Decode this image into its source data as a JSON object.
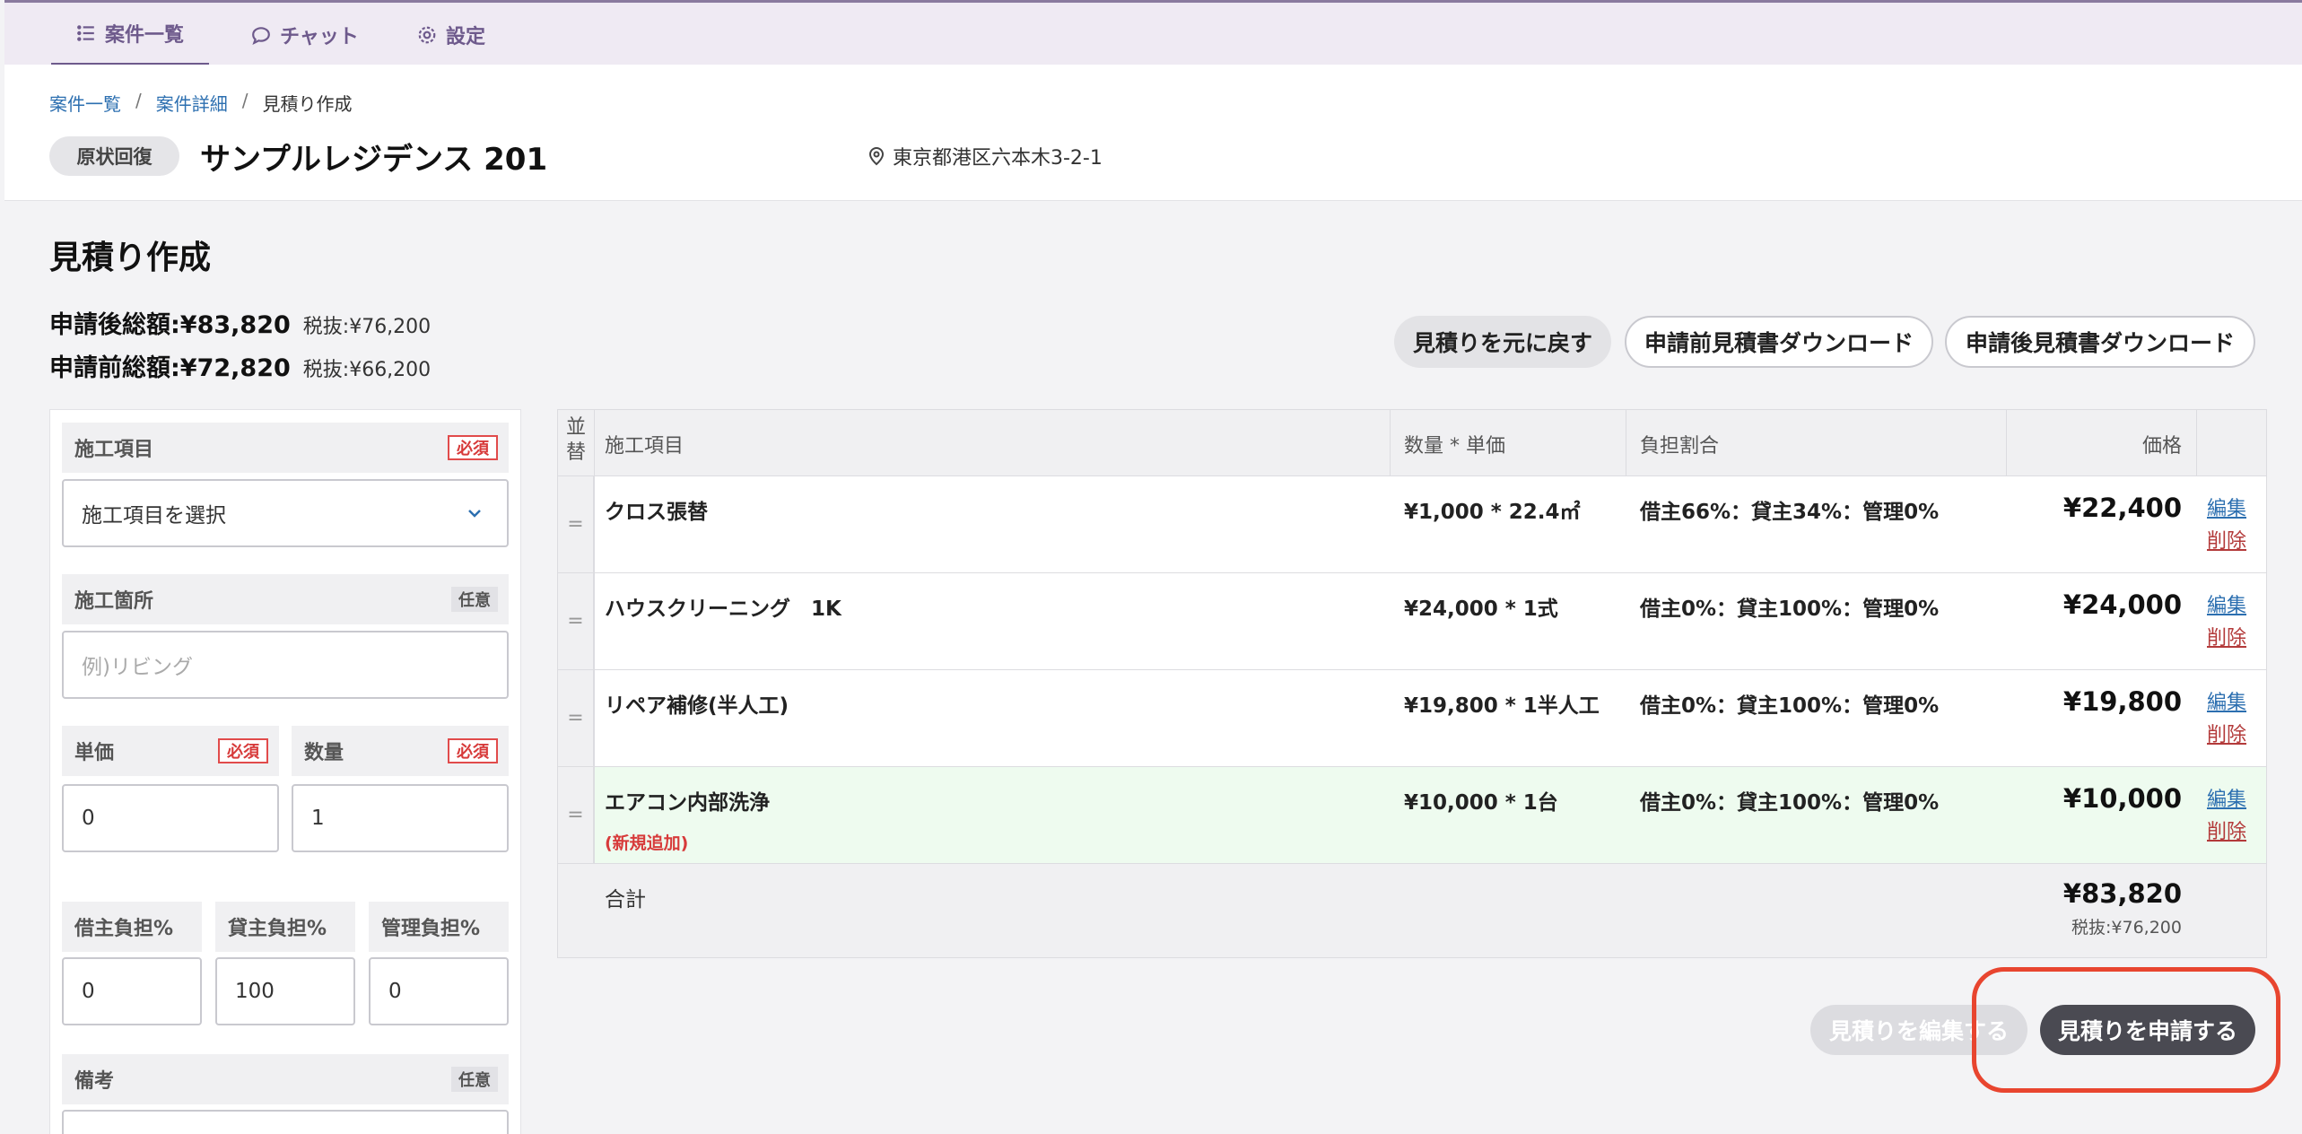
{
  "nav": {
    "tabs": [
      {
        "label": "案件一覧",
        "icon": "list-icon"
      },
      {
        "label": "チャット",
        "icon": "chat-icon"
      },
      {
        "label": "設定",
        "icon": "gear-icon"
      }
    ]
  },
  "breadcrumb": {
    "items": [
      "案件一覧",
      "案件詳細",
      "見積り作成"
    ],
    "sep": "/"
  },
  "header": {
    "category_badge": "原状回復",
    "property_name": "サンプルレジデンス 201",
    "address": "東京都港区六本木3-2-1"
  },
  "page": {
    "title": "見積り作成",
    "after_total_label": "申請後総額:¥83,820",
    "after_total_ex": "税抜:¥76,200",
    "before_total_label": "申請前総額:¥72,820",
    "before_total_ex": "税抜:¥66,200"
  },
  "actions": {
    "revert": "見積りを元に戻す",
    "download_before": "申請前見積書ダウンロード",
    "download_after": "申請後見積書ダウンロード",
    "edit_estimate": "見積りを編集する",
    "submit_estimate": "見積りを申請する"
  },
  "form": {
    "required": "必須",
    "optional": "任意",
    "work_item_label": "施工項目",
    "work_item_placeholder": "施工項目を選択",
    "location_label": "施工箇所",
    "location_placeholder": "例)リビング",
    "unit_price_label": "単価",
    "unit_price_value": "0",
    "quantity_label": "数量",
    "quantity_value": "1",
    "tenant_label": "借主負担%",
    "tenant_value": "0",
    "landlord_label": "貸主負担%",
    "landlord_value": "100",
    "mgmt_label": "管理負担%",
    "mgmt_value": "0",
    "remarks_label": "備考"
  },
  "table": {
    "headers": {
      "sort": "並替",
      "item": "施工項目",
      "qty_price": "数量 * 単価",
      "ratio": "負担割合",
      "price": "価格"
    },
    "rows": [
      {
        "item": "クロス張替",
        "qty": "¥1,000 * 22.4㎡",
        "ratio": "借主66%：貸主34%：管理0%",
        "price": "¥22,400"
      },
      {
        "item": "ハウスクリーニング　1K",
        "qty": "¥24,000 * 1式",
        "ratio": "借主0%：貸主100%：管理0%",
        "price": "¥24,000"
      },
      {
        "item": "リペア補修(半人工)",
        "qty": "¥19,800 * 1半人工",
        "ratio": "借主0%：貸主100%：管理0%",
        "price": "¥19,800"
      },
      {
        "item": "エアコン内部洗浄",
        "qty": "¥10,000 * 1台",
        "ratio": "借主0%：貸主100%：管理0%",
        "price": "¥10,000",
        "tag": "(新規追加)"
      }
    ],
    "edit_label": "編集",
    "delete_label": "削除",
    "handle": "=",
    "total_label": "合計",
    "total_price": "¥83,820",
    "total_ex": "税抜:¥76,200"
  },
  "colors": {
    "accent": "#6e5a8c",
    "link": "#2c6fb0",
    "danger": "#d73a3a",
    "new_row_bg": "#eefbef",
    "highlight": "#e8452f"
  }
}
